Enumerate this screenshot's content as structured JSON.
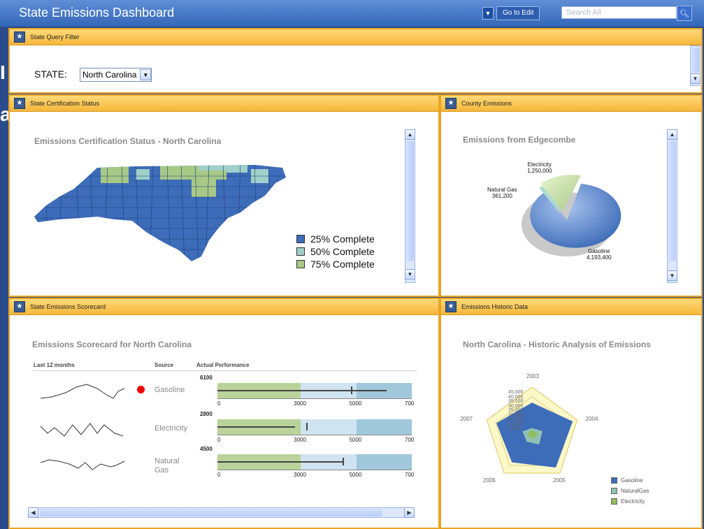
{
  "app": {
    "title": "State Emissions Dashboard",
    "go_to_edit": "Go to Edit",
    "search_placeholder": "Search All"
  },
  "filter_panel": {
    "title": "State Query Filter",
    "state_label": "STATE:",
    "state_value": "North Carolina"
  },
  "cert_panel": {
    "title": "State Certification Status",
    "chart_title": "Emissions Certification Status - North Carolina",
    "legend": [
      {
        "label": "25% Complete",
        "color": "#3d6cb9"
      },
      {
        "label": "50% Complete",
        "color": "#9fd0c9"
      },
      {
        "label": "75% Complete",
        "color": "#a8c986"
      }
    ]
  },
  "county_panel": {
    "title": "County Emissions",
    "chart_title": "Emissions from Edgecombe",
    "slices": [
      {
        "name": "Electricity",
        "value_label": "1,250,000"
      },
      {
        "name": "Natural Gas",
        "value_label": "361,200"
      },
      {
        "name": "Gasoline",
        "value_label": "4,193,400"
      }
    ]
  },
  "scorecard_panel": {
    "title": "State Emissions Scorecard",
    "chart_title": "Emissions Scorecard for North Carolina",
    "headers": {
      "period": "Last 12 months",
      "source": "Source",
      "performance": "Actual Performance"
    },
    "rows": [
      {
        "source": "Gasoline",
        "value_label": "6100",
        "ticks": [
          "0",
          "3000",
          "5000",
          "700"
        ]
      },
      {
        "source": "Electricity",
        "value_label": "2800",
        "ticks": [
          "0",
          "3000",
          "5000",
          "700"
        ]
      },
      {
        "source": "Natural Gas",
        "value_label": "4500",
        "ticks": [
          "0",
          "3000",
          "5000",
          "700"
        ]
      }
    ]
  },
  "historic_panel": {
    "title": "Emissions Historic Data",
    "chart_title": "North Carolina - Historic Analysis of Emissions",
    "years": [
      "2003",
      "2004",
      "2005",
      "2006",
      "2007"
    ],
    "scale_labels": [
      "45,000",
      "40,000",
      "35,000",
      "30,000",
      "25,000",
      "20,000",
      "15,000",
      "10,000",
      "5,000"
    ],
    "legend": [
      {
        "label": "Gasoline",
        "color": "#3d6cb9"
      },
      {
        "label": "NaturalGas",
        "color": "#8fc1b6"
      },
      {
        "label": "Electricity",
        "color": "#8fbe5e"
      }
    ]
  },
  "chart_data": [
    {
      "type": "pie",
      "title": "Emissions from Edgecombe",
      "categories": [
        "Gasoline",
        "Electricity",
        "Natural Gas"
      ],
      "values": [
        4193400,
        1250000,
        361200
      ]
    },
    {
      "type": "bar",
      "title": "Emissions Scorecard for North Carolina",
      "categories": [
        "Gasoline",
        "Electricity",
        "Natural Gas"
      ],
      "values": [
        6100,
        2800,
        4500
      ],
      "targets": [
        4800,
        3200,
        4500
      ],
      "bands": [
        3000,
        5000,
        7000
      ],
      "xlim": [
        0,
        7000
      ]
    },
    {
      "type": "radar",
      "title": "North Carolina - Historic Analysis of Emissions",
      "categories": [
        "2003",
        "2004",
        "2005",
        "2006",
        "2007"
      ],
      "ylim": [
        0,
        45000
      ],
      "series": [
        {
          "name": "Gasoline",
          "values": [
            30000,
            40000,
            38000,
            32000,
            35000
          ]
        },
        {
          "name": "NaturalGas",
          "values": [
            6000,
            10000,
            11000,
            8000,
            9000
          ]
        },
        {
          "name": "Electricity",
          "values": [
            4000,
            5000,
            4000,
            3000,
            4000
          ]
        }
      ]
    }
  ]
}
